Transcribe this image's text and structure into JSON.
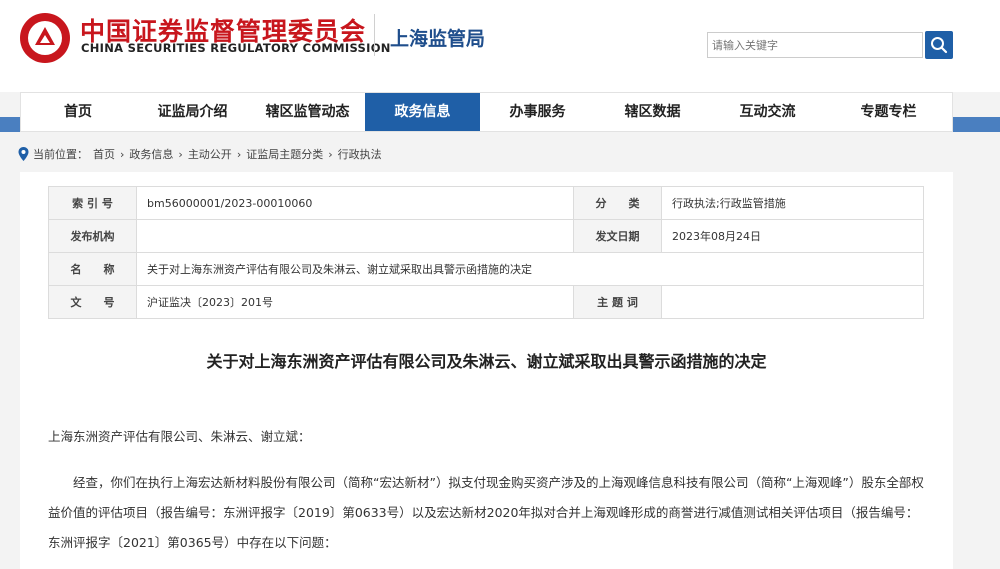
{
  "header": {
    "org_cn": "中国证券监督管理委员会",
    "org_en": "CHINA SECURITIES REGULATORY COMMISSION",
    "bureau": "上海监管局",
    "search_placeholder": "请输入关键字",
    "logo_icon": "csrc-emblem",
    "search_icon": "magnifier",
    "brand_red": "#c8161d",
    "brand_blue": "#1f5fa7"
  },
  "nav": {
    "items": [
      "首页",
      "证监局介绍",
      "辖区监管动态",
      "政务信息",
      "办事服务",
      "辖区数据",
      "互动交流",
      "专题专栏"
    ],
    "active": "政务信息"
  },
  "breadcrumb": {
    "label": "当前位置：",
    "items": [
      "首页",
      "政务信息",
      "主动公开",
      "证监局主题分类",
      "行政执法"
    ],
    "sep": "›"
  },
  "meta": {
    "index_label": "索 引 号",
    "index_value": "bm56000001/2023-00010060",
    "category_label": "分　　类",
    "category_value": "行政执法;行政监管措施",
    "issuer_label": "发布机构",
    "issuer_value": "",
    "date_label": "发文日期",
    "date_value": "2023年08月24日",
    "name_label": "名　　称",
    "name_value": "关于对上海东洲资产评估有限公司及朱淋云、谢立斌采取出具警示函措施的决定",
    "docno_label": "文　　号",
    "docno_value": "沪证监决〔2023〕201号",
    "keyword_label": "主 题 词",
    "keyword_value": ""
  },
  "article": {
    "title": "关于对上海东洲资产评估有限公司及朱淋云、谢立斌采取出具警示函措施的决定",
    "salutation": "上海东洲资产评估有限公司、朱淋云、谢立斌：",
    "paragraph": "经查，你们在执行上海宏达新材料股份有限公司（简称“宏达新材”）拟支付现金购买资产涉及的上海观峰信息科技有限公司（简称“上海观峰”）股东全部权益价值的评估项目（报告编号：东洲评报字〔2019〕第0633号）以及宏达新材2020年拟对合并上海观峰形成的商誉进行减值测试相关评估项目（报告编号：东洲评报字〔2021〕第0365号）中存在以下问题："
  }
}
